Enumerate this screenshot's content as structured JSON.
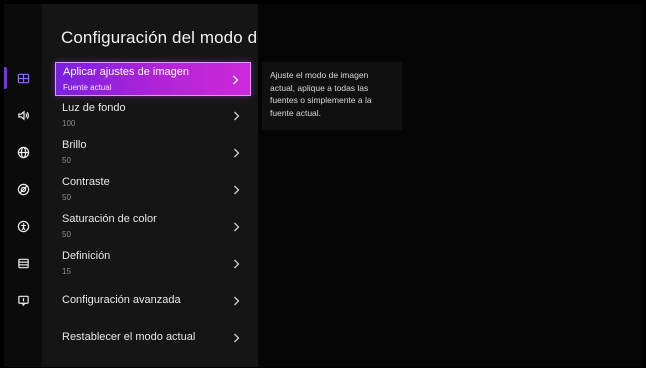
{
  "sidebar": {
    "items": [
      {
        "icon": "picture-icon",
        "active": true
      },
      {
        "icon": "sound-icon",
        "active": false
      },
      {
        "icon": "network-icon",
        "active": false
      },
      {
        "icon": "privacy-icon",
        "active": false
      },
      {
        "icon": "accessibility-icon",
        "active": false
      },
      {
        "icon": "system-icon",
        "active": false
      },
      {
        "icon": "support-icon",
        "active": false
      }
    ],
    "accent_color": "#7b2cf5"
  },
  "panel": {
    "title": "Configuración del modo de imagen",
    "items": [
      {
        "label": "Aplicar ajustes de imagen",
        "value": "Fuente actual",
        "selected": true
      },
      {
        "label": "Luz de fondo",
        "value": "100"
      },
      {
        "label": "Brillo",
        "value": "50"
      },
      {
        "label": "Contraste",
        "value": "50"
      },
      {
        "label": "Saturación de color",
        "value": "50"
      },
      {
        "label": "Definición",
        "value": "15"
      },
      {
        "label": "Configuración avanzada"
      },
      {
        "label": "Restablecer el modo actual"
      }
    ],
    "selection_gradient": [
      "#7a20e0",
      "#cc2ad8"
    ]
  },
  "description": {
    "text": "Ajuste el modo de imagen actual, aplique a todas las fuentes o simplemente a la fuente actual."
  }
}
